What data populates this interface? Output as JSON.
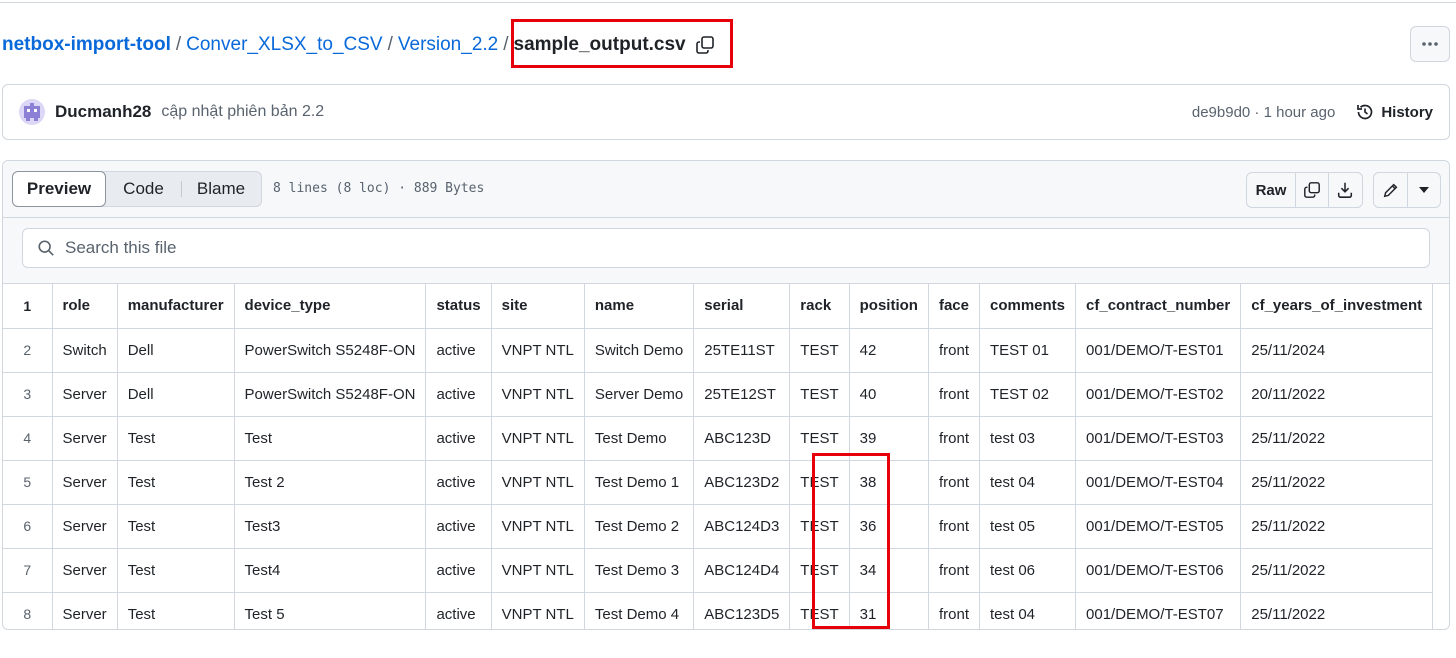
{
  "breadcrumb": {
    "repo": "netbox-import-tool",
    "folder1": "Conver_XLSX_to_CSV",
    "folder2": "Version_2.2",
    "file": "sample_output.csv",
    "separator": "/"
  },
  "commit": {
    "author": "Ducmanh28",
    "message": "cập nhật phiên bản 2.2",
    "sha_time": "de9b9d0 · 1 hour ago",
    "history_label": "History"
  },
  "file_header": {
    "tabs": [
      "Preview",
      "Code",
      "Blame"
    ],
    "info": "8 lines (8 loc) · 889 Bytes",
    "raw_label": "Raw"
  },
  "search": {
    "placeholder": "Search this file"
  },
  "table": {
    "line_numbers": [
      "1",
      "2",
      "3",
      "4",
      "5",
      "6",
      "7",
      "8"
    ],
    "columns": [
      "role",
      "manufacturer",
      "device_type",
      "status",
      "site",
      "name",
      "serial",
      "rack",
      "position",
      "face",
      "comments",
      "cf_contract_number",
      "cf_years_of_investment"
    ],
    "rows": [
      [
        "Switch",
        "Dell",
        "PowerSwitch S5248F-ON",
        "active",
        "VNPT NTL",
        "Switch Demo",
        "25TE11ST",
        "TEST",
        "42",
        "front",
        "TEST 01",
        "001/DEMO/T-EST01",
        "25/11/2024"
      ],
      [
        "Server",
        "Dell",
        "PowerSwitch S5248F-ON",
        "active",
        "VNPT NTL",
        "Server Demo",
        "25TE12ST",
        "TEST",
        "40",
        "front",
        "TEST 02",
        "001/DEMO/T-EST02",
        "20/11/2022"
      ],
      [
        "Server",
        "Test",
        "Test",
        "active",
        "VNPT NTL",
        "Test Demo",
        "ABC123D",
        "TEST",
        "39",
        "front",
        "test 03",
        "001/DEMO/T-EST03",
        "25/11/2022"
      ],
      [
        "Server",
        "Test",
        "Test 2",
        "active",
        "VNPT NTL",
        "Test Demo 1",
        "ABC123D2",
        "TEST",
        "38",
        "front",
        "test 04",
        "001/DEMO/T-EST04",
        "25/11/2022"
      ],
      [
        "Server",
        "Test",
        "Test3",
        "active",
        "VNPT NTL",
        "Test Demo 2",
        "ABC124D3",
        "TEST",
        "36",
        "front",
        "test 05",
        "001/DEMO/T-EST05",
        "25/11/2022"
      ],
      [
        "Server",
        "Test",
        "Test4",
        "active",
        "VNPT NTL",
        "Test Demo 3",
        "ABC124D4",
        "TEST",
        "34",
        "front",
        "test 06",
        "001/DEMO/T-EST06",
        "25/11/2022"
      ],
      [
        "Server",
        "Test",
        "Test 5",
        "active",
        "VNPT NTL",
        "Test Demo 4",
        "ABC123D5",
        "TEST",
        "31",
        "front",
        "test 04",
        "001/DEMO/T-EST07",
        "25/11/2022"
      ]
    ]
  },
  "colors": {
    "link": "#0969da",
    "highlight": "#e5000a",
    "border": "#d0d7de",
    "muted": "#59636e"
  }
}
